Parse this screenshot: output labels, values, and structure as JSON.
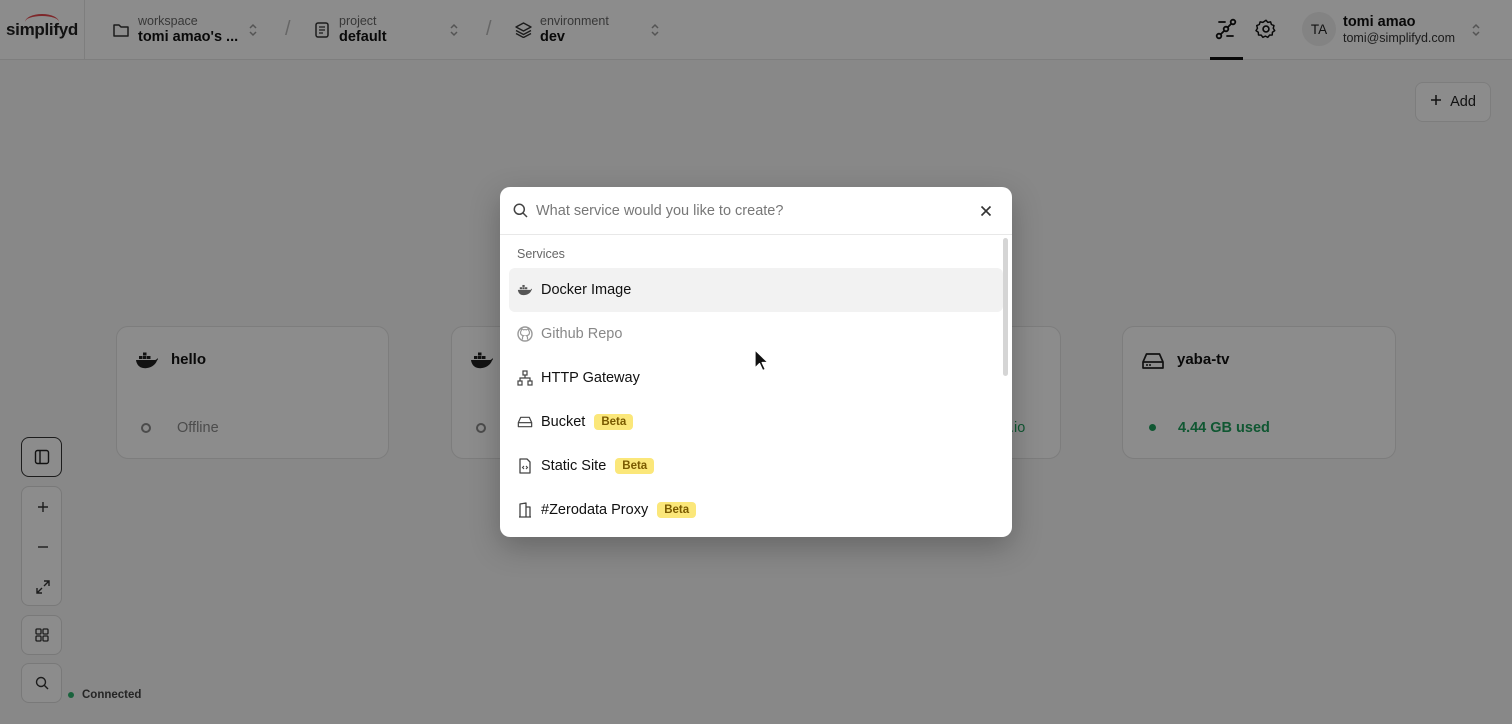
{
  "logo": {
    "text": "simplifyd"
  },
  "breadcrumbs": {
    "workspace": {
      "label": "workspace",
      "value": "tomi amao's ..."
    },
    "project": {
      "label": "project",
      "value": "default"
    },
    "environment": {
      "label": "environment",
      "value": "dev"
    },
    "separator": "/"
  },
  "user": {
    "initials": "TA",
    "name": "tomi amao",
    "email": "tomi@simplifyd.com"
  },
  "toolbar": {
    "add_label": "Add"
  },
  "cards": [
    {
      "title": "hello",
      "status": "Offline",
      "status_color": "#8a8a8a",
      "icon": "docker-icon"
    },
    {
      "title": "yaba-tv",
      "status": "4.44 GB used",
      "status_color": "#1e9e5c",
      "icon": "drive-icon"
    }
  ],
  "partial_card": {
    "status_suffix": ".io"
  },
  "status_bar": {
    "connected": "Connected"
  },
  "modal": {
    "search_placeholder": "What service would you like to create?",
    "section_label": "Services",
    "items": [
      {
        "label": "Docker Image",
        "icon": "docker-icon",
        "badge": ""
      },
      {
        "label": "Github Repo",
        "icon": "github-icon",
        "badge": ""
      },
      {
        "label": "HTTP Gateway",
        "icon": "network-icon",
        "badge": ""
      },
      {
        "label": "Bucket",
        "icon": "drive-icon",
        "badge": "Beta"
      },
      {
        "label": "Static Site",
        "icon": "file-code-icon",
        "badge": "Beta"
      },
      {
        "label": "#Zerodata Proxy",
        "icon": "building-icon",
        "badge": "Beta"
      }
    ]
  },
  "colors": {
    "accent_logo": "#e5484d",
    "beta_badge": "#fbe77a",
    "connected_dot": "#2fb36d"
  }
}
